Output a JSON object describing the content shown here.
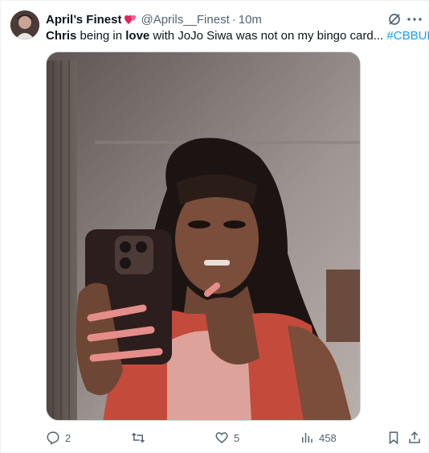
{
  "author": {
    "display_name": "April’s Finest",
    "handle": "@Aprils__Finest",
    "separator": "·",
    "time": "10m",
    "badge_icon": "two-hearts-icon"
  },
  "tweet": {
    "part1": "Chris",
    "part2": " being in ",
    "part3": "love",
    "part4": " with JoJo Siwa was not on my bingo card... ",
    "hashtag": "#CBBUK",
    "media_icon": "video-still-image"
  },
  "actions": {
    "replies": "2",
    "reposts": "",
    "likes": "5",
    "views": "458"
  },
  "colors": {
    "text": "#0f1419",
    "secondary": "#536471",
    "link": "#1d9bf0"
  }
}
